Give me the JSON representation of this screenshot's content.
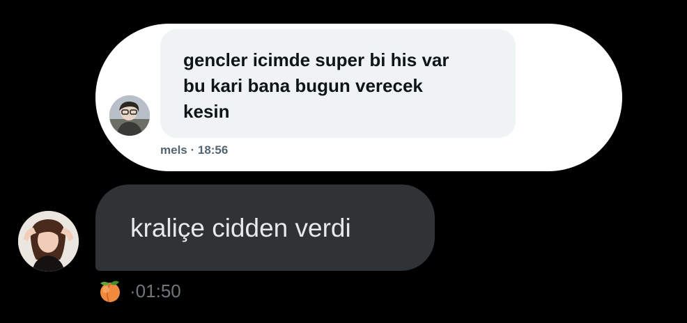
{
  "quoted_message": {
    "text": "gencler icimde super bi his var\nbu kari bana bugun verecek\nkesin",
    "author": "mels",
    "separator": " · ",
    "time": "18:56",
    "avatar_icon": "user-avatar-icon"
  },
  "reply_message": {
    "text": "kraliçe cidden verdi",
    "reaction_icon": "peach-emoji-icon",
    "separator": "·",
    "time": "01:50",
    "avatar_icon": "user-avatar-icon"
  },
  "colors": {
    "background": "#000000",
    "quote_card": "#ffffff",
    "quote_bubble": "#eff3f4",
    "reply_bubble": "#2f3336",
    "muted_text": "#71767b"
  }
}
